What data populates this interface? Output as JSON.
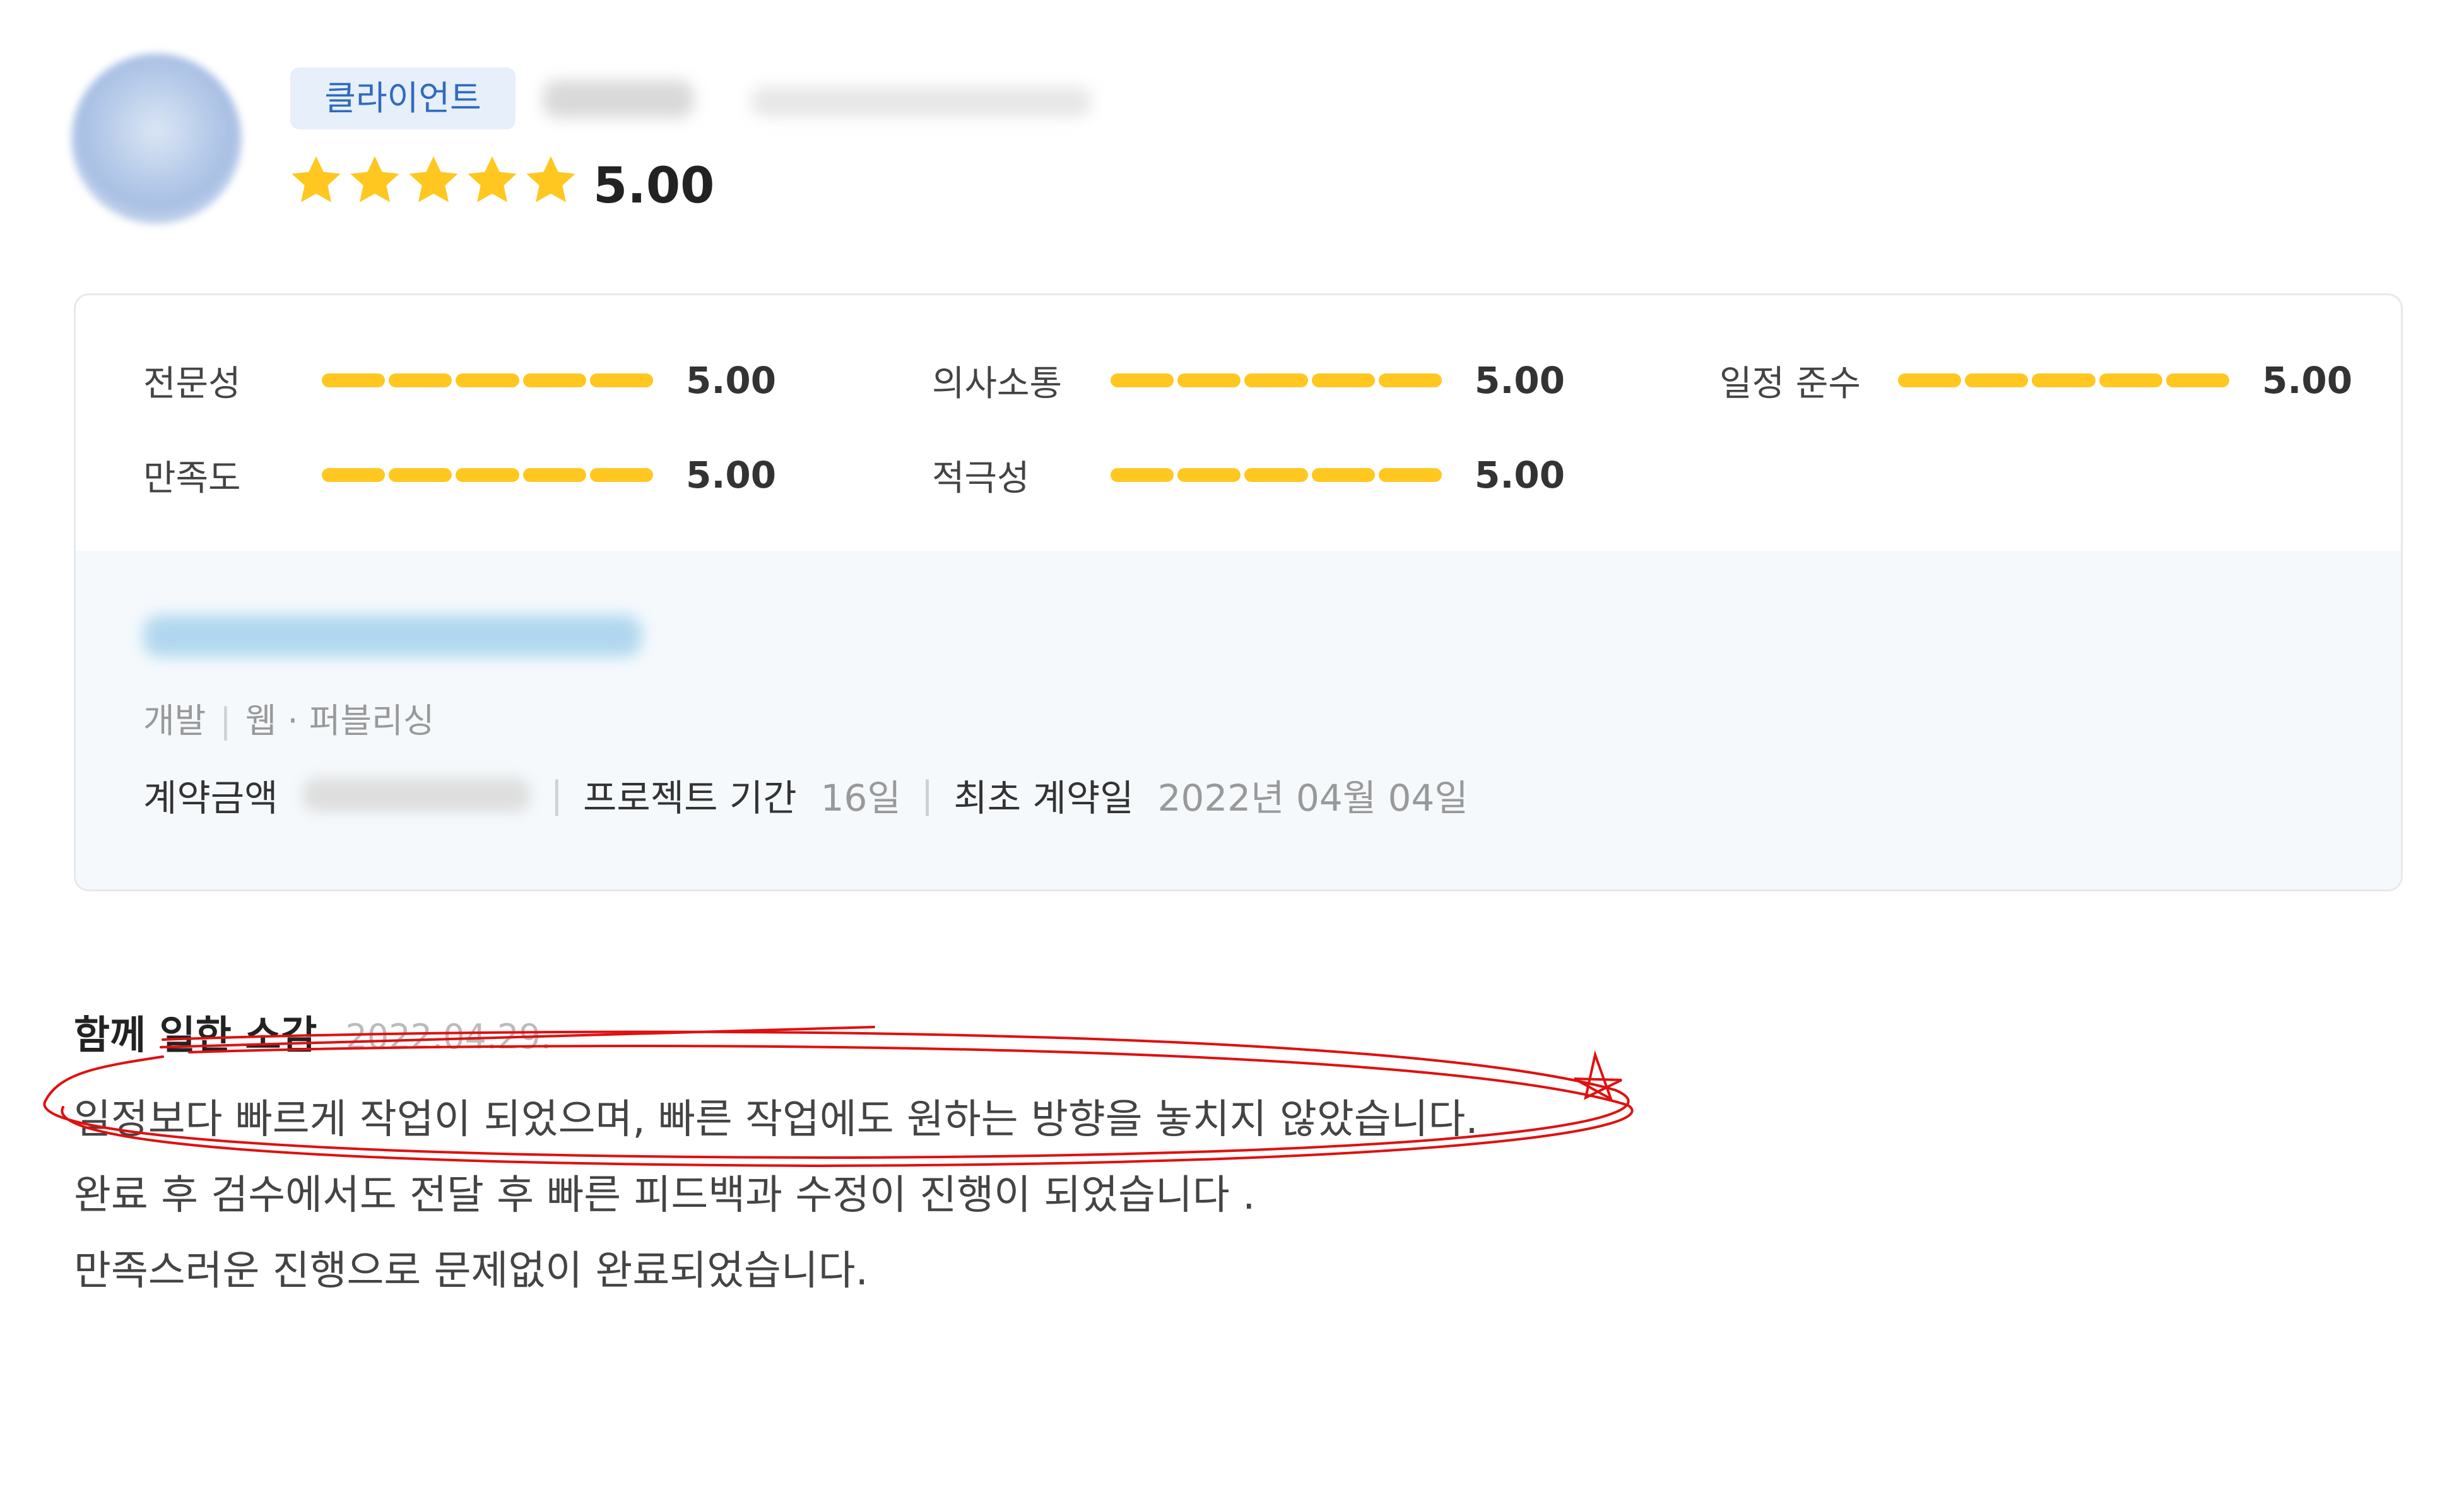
{
  "reviewer": {
    "role_badge": "클라이언트",
    "rating": 5,
    "rating_text": "5.00"
  },
  "categories": [
    {
      "label": "전문성",
      "score": "5.00"
    },
    {
      "label": "의사소통",
      "score": "5.00"
    },
    {
      "label": "일정 준수",
      "score": "5.00"
    },
    {
      "label": "만족도",
      "score": "5.00"
    },
    {
      "label": "적극성",
      "score": "5.00"
    }
  ],
  "project": {
    "category_main": "개발",
    "category_sub": "웹 · 퍼블리싱",
    "amount_label": "계약금액",
    "period_label": "프로젝트 기간",
    "period_value": "16일",
    "contract_date_label": "최초 계약일",
    "contract_date_value": "2022년 04월 04일"
  },
  "review": {
    "title": "함께 일한 소감",
    "date": "2022.04.29.",
    "lines": [
      "일정보다 빠르게 작업이 되었으며, 빠른 작업에도 원하는 방향을 놓치지 않았습니다.",
      "완료 후 검수에서도 전달 후 빠른 피드백과 수정이 진행이 되었습니다 .",
      "만족스러운 진행으로 문제없이 완료되었습니다."
    ]
  },
  "colors": {
    "star": "#ffc720",
    "bar": "#ffc720",
    "badge_bg": "#e6effa",
    "badge_text": "#2f6bbf",
    "annotation": "#e01010"
  }
}
